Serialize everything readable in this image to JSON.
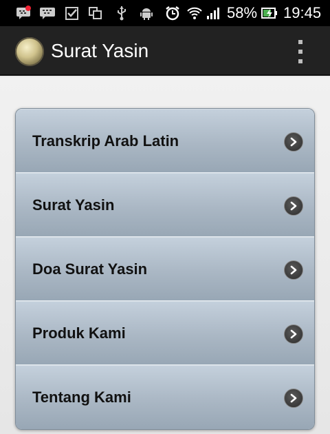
{
  "status_bar": {
    "battery_percent": "58%",
    "time": "19:45",
    "icons": [
      "bbm-notification-icon",
      "bbm-icon",
      "checkbox-icon",
      "copy-icon",
      "usb-icon",
      "android-icon",
      "alarm-icon",
      "wifi-icon",
      "signal-icon",
      "battery-charging-icon"
    ]
  },
  "action_bar": {
    "title": "Surat Yasin",
    "logo_icon": "quran-logo-icon",
    "overflow_icon": "overflow-menu-icon"
  },
  "menu": {
    "items": [
      {
        "label": "Transkrip Arab Latin",
        "icon": "chevron-right-icon"
      },
      {
        "label": "Surat Yasin",
        "icon": "chevron-right-icon"
      },
      {
        "label": "Doa Surat Yasin",
        "icon": "chevron-right-icon"
      },
      {
        "label": "Produk Kami",
        "icon": "chevron-right-icon"
      },
      {
        "label": "Tentang Kami",
        "icon": "chevron-right-icon"
      }
    ]
  },
  "colors": {
    "status_bar_bg": "#000000",
    "action_bar_bg": "#222222",
    "menu_item_gradient_top": "#c4d0dc",
    "menu_item_gradient_bottom": "#98a7b5"
  }
}
